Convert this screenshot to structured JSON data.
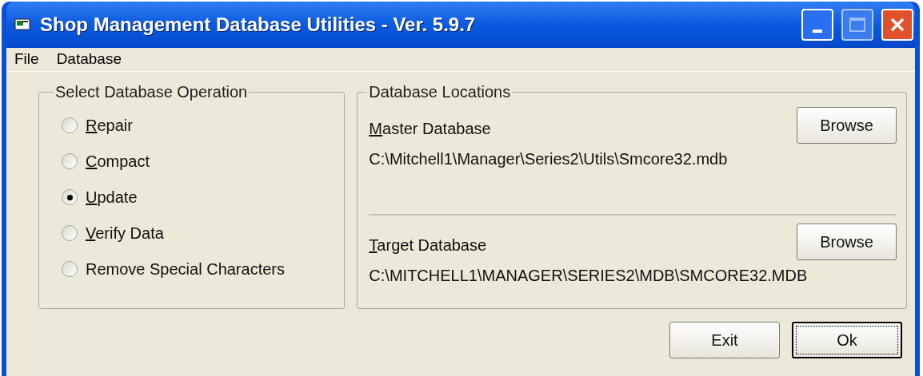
{
  "window": {
    "title": "Shop Management Database Utilities - Ver. 5.9.7"
  },
  "menu": [
    "File",
    "Database"
  ],
  "operations": {
    "title": "Select Database Operation",
    "options": [
      {
        "label": "Repair",
        "access_key_underlined": true,
        "selected": false
      },
      {
        "label": "Compact",
        "access_key_underlined": true,
        "selected": false
      },
      {
        "label": "Update",
        "access_key_underlined": true,
        "selected": true
      },
      {
        "label": "Verify Data",
        "access_key_underlined": true,
        "selected": false
      },
      {
        "label": "Remove Special Characters",
        "access_key_underlined": false,
        "selected": false
      }
    ]
  },
  "locations": {
    "title": "Database Locations",
    "entries": [
      {
        "label": "Master Database",
        "access_key_underlined": true,
        "button": "Browse",
        "path": "C:\\Mitchell1\\Manager\\Series2\\Utils\\Smcore32.mdb"
      },
      {
        "label": "Target Database",
        "access_key_underlined": true,
        "button": "Browse",
        "path": "C:\\MITCHELL1\\MANAGER\\SERIES2\\MDB\\SMCORE32.MDB"
      }
    ]
  },
  "buttons": [
    {
      "label": "Exit",
      "default": false
    },
    {
      "label": "Ok",
      "default": true
    }
  ]
}
